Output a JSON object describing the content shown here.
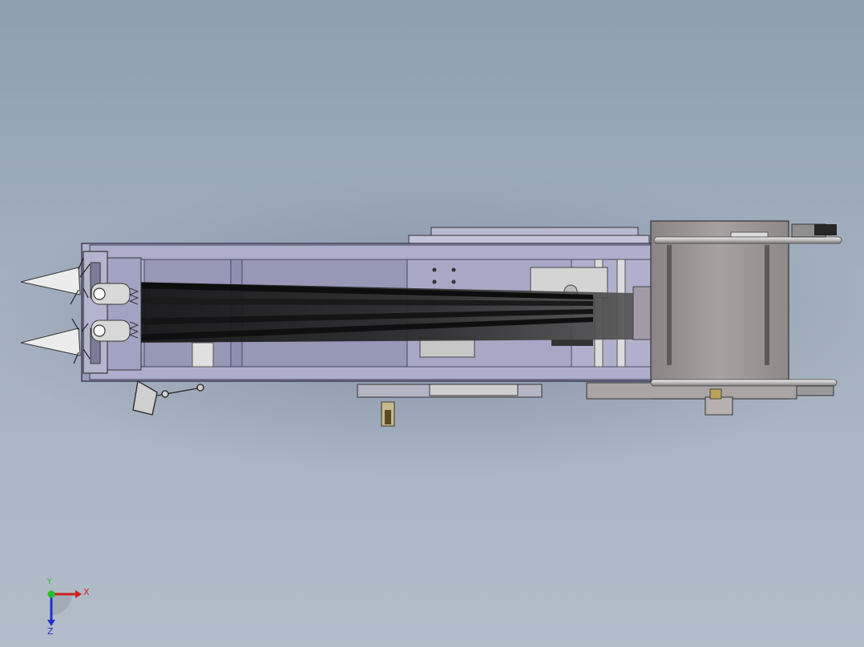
{
  "viewport": {
    "background_top": "#8e9fb2",
    "background_bottom": "#b3bdca"
  },
  "model": {
    "frame_color": "#a6a6c8",
    "frame_edge": "#3c3c52",
    "belt_color": "#1a1a1a",
    "tank_color": "#9c9696",
    "nozzle_color": "#e8e8e8"
  },
  "triad": {
    "x_label": "X",
    "y_label": "Y",
    "z_label": "Z",
    "x_color": "#d02020",
    "y_color": "#20c020",
    "z_color": "#2030c8"
  }
}
